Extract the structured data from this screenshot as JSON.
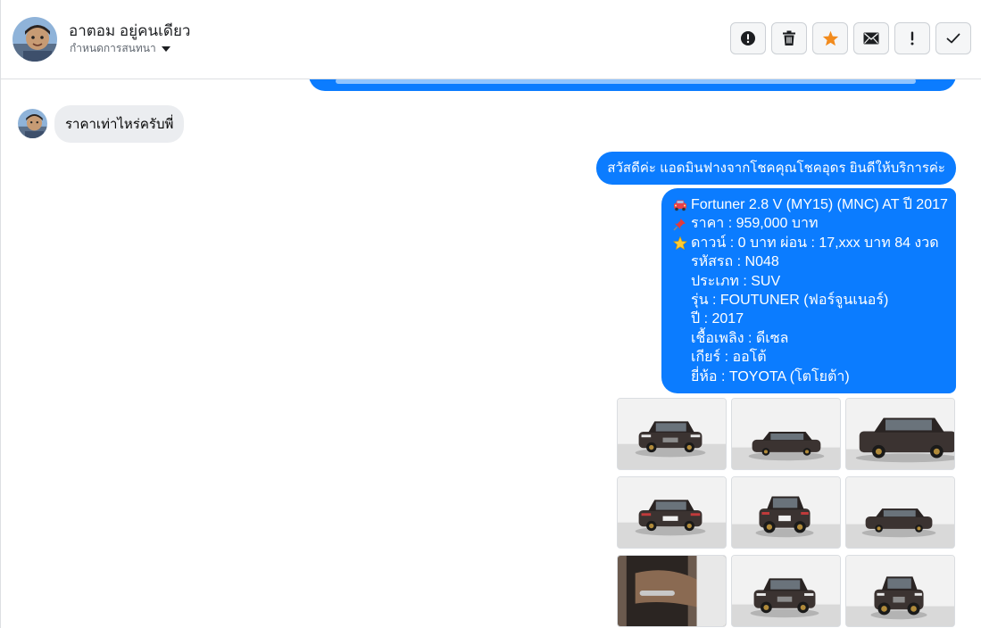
{
  "header": {
    "contact_name": "อาตอม อยู่คนเดียว",
    "status_label": "กำหนดการสนทนา",
    "toolbar": [
      {
        "name": "spam-button",
        "icon": "alert-circle-icon"
      },
      {
        "name": "delete-button",
        "icon": "trash-icon"
      },
      {
        "name": "star-button",
        "icon": "star-icon",
        "color": "#f28b1d"
      },
      {
        "name": "mark-unread-button",
        "icon": "envelope-icon"
      },
      {
        "name": "important-button",
        "icon": "exclamation-icon"
      },
      {
        "name": "done-button",
        "icon": "check-icon"
      }
    ]
  },
  "messages": {
    "incoming": "ราคาเท่าไหร่ครับพี่",
    "greeting": "สวัสดีค่ะ แอดมินฟางจากโชคคุณโชคอุดร ยินดีให้บริการค่ะ",
    "details": [
      {
        "emoji": "car-icon",
        "text": "Fortuner 2.8 V (MY15) (MNC) AT ปี 2017"
      },
      {
        "emoji": "pushpin-icon",
        "text": "ราคา : 959,000 บาท"
      },
      {
        "emoji": "star-icon",
        "text": "ดาวน์ : 0 บาท ผ่อน : 17,xxx  บาท 84 งวด"
      },
      {
        "emoji": "",
        "text": "รหัสรถ : N048"
      },
      {
        "emoji": "",
        "text": "ประเภท : SUV"
      },
      {
        "emoji": "",
        "text": "รุ่น : FOUTUNER (ฟอร์จูนเนอร์)"
      },
      {
        "emoji": "",
        "text": "ปี : 2017"
      },
      {
        "emoji": "",
        "text": "เชื้อเพลิง : ดีเซล"
      },
      {
        "emoji": "",
        "text": "เกียร์ : ออโต้"
      },
      {
        "emoji": "",
        "text": "ยี่ห้อ : TOYOTA (โตโยต้า)"
      }
    ],
    "photo_count": 9
  },
  "colors": {
    "outgoing_bubble": "#0b7cff",
    "incoming_bubble": "#ebedf0",
    "star_accent": "#f28b1d"
  }
}
